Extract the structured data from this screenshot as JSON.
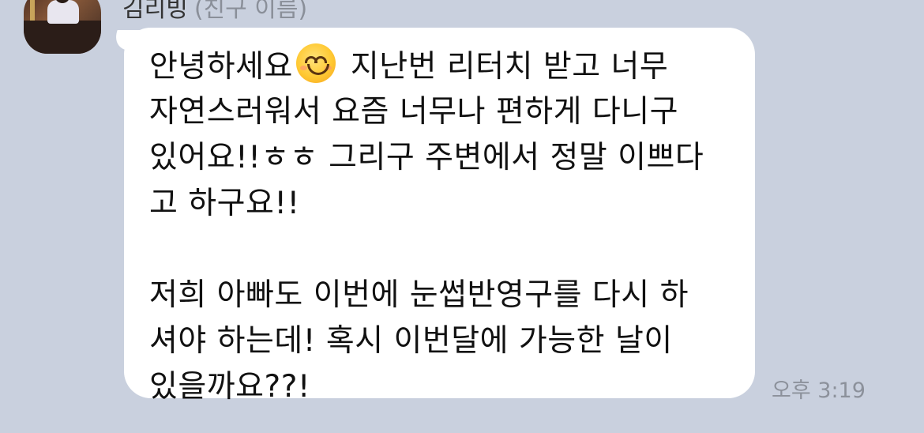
{
  "sender": {
    "name": "김리빙",
    "subtitle": "(친구 이름)"
  },
  "message": {
    "line1_before_emoji": "안녕하세요",
    "emoji": "smiling-face-icon",
    "line1_after_emoji": "지난번 리터치 받고 너무",
    "line2": "자연스러워서 요즘 너무나 편하게 다니구",
    "line3": "있어요!!ㅎㅎ 그리구 주변에서 정말 이쁘다",
    "line4": "고 하구요!!",
    "line5": "저희 아빠도 이번에 눈썹반영구를 다시 하",
    "line6": "셔야 하는데! 혹시 이번달에 가능한 날이",
    "line7": "있을까요??!"
  },
  "timestamp": "오후 3:19",
  "colors": {
    "background": "#c9d0de",
    "bubble": "#ffffff",
    "text": "#111111",
    "timestamp": "#8c919b"
  }
}
